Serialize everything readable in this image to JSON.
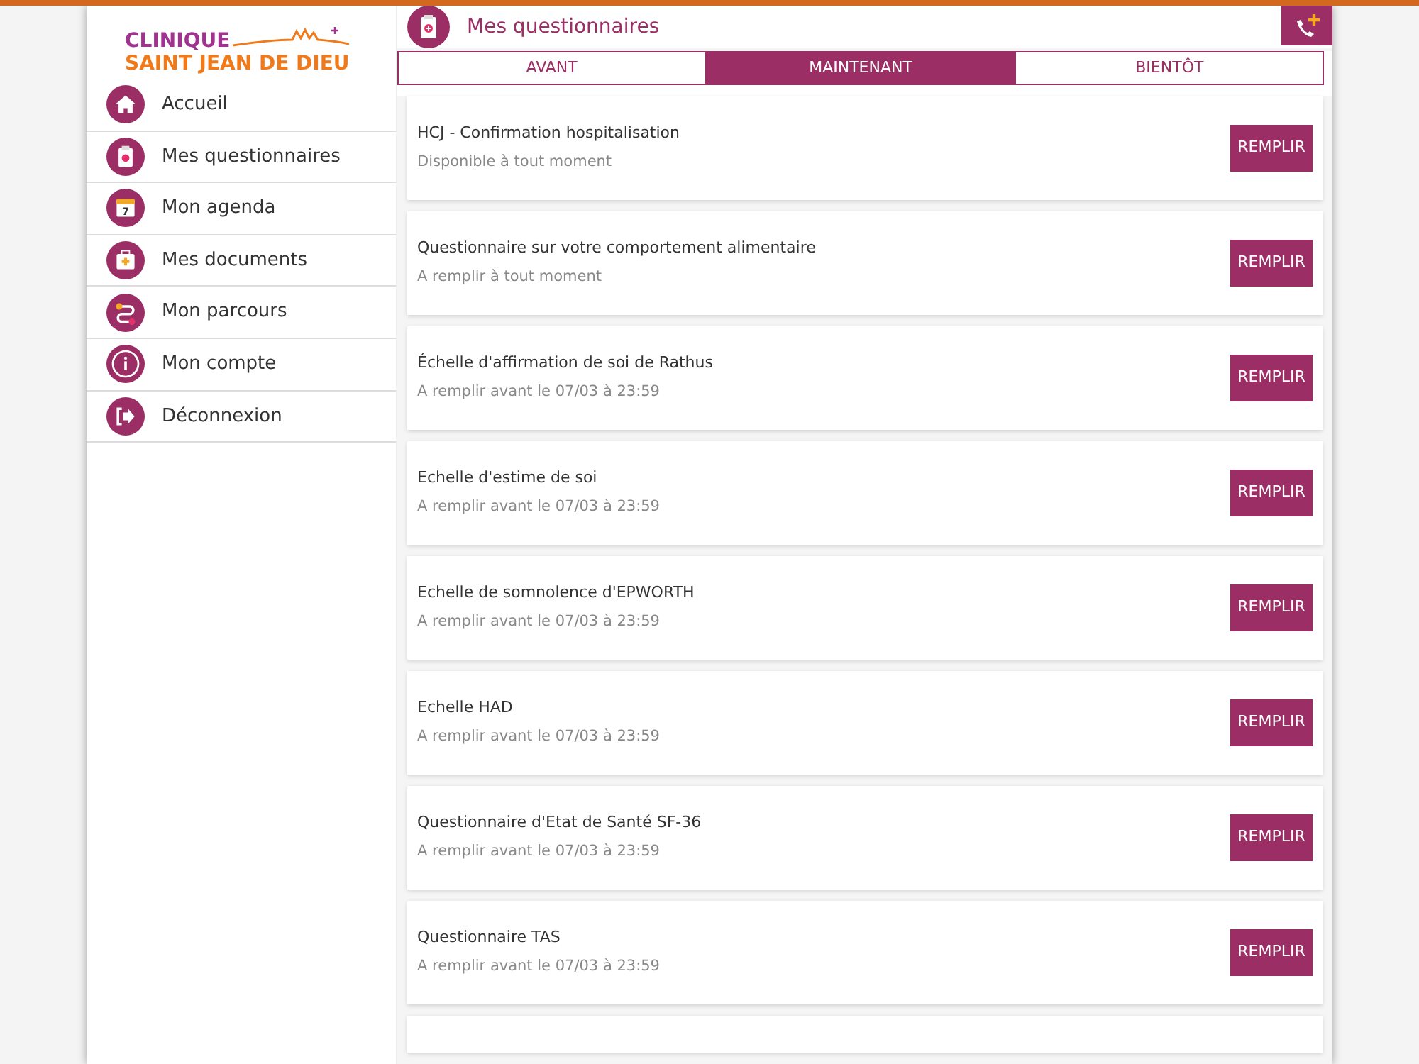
{
  "logo": {
    "line1": "CLINIQUE",
    "line2": "SAINT JEAN DE DIEU"
  },
  "sidebar": {
    "items": [
      {
        "label": "Accueil",
        "selected": false
      },
      {
        "label": "Mes questionnaires",
        "selected": false
      },
      {
        "label": "Mon agenda",
        "icon_text": "7",
        "selected": false
      },
      {
        "label": "Mes documents",
        "selected": false
      },
      {
        "label": "Mon parcours",
        "selected": false
      },
      {
        "label": "Mon compte",
        "selected": false
      },
      {
        "label": "Déconnexion",
        "selected": false
      }
    ]
  },
  "header": {
    "title": "Mes questionnaires"
  },
  "tabs": [
    {
      "label": "AVANT",
      "selected": false
    },
    {
      "label": "MAINTENANT",
      "selected": true
    },
    {
      "label": "BIENTÔT",
      "selected": false
    }
  ],
  "questionnaires": [
    {
      "title": "HCJ - Confirmation hospitalisation",
      "subtitle": "Disponible à tout moment",
      "button": "REMPLIR"
    },
    {
      "title": "Questionnaire sur votre comportement alimentaire",
      "subtitle": "A remplir à tout moment",
      "button": "REMPLIR"
    },
    {
      "title": "Échelle d'affirmation de soi de Rathus",
      "subtitle": "A remplir avant le 07/03 à 23:59",
      "button": "REMPLIR"
    },
    {
      "title": "Echelle d'estime de soi",
      "subtitle": "A remplir avant le 07/03 à 23:59",
      "button": "REMPLIR"
    },
    {
      "title": "Echelle de somnolence d'EPWORTH",
      "subtitle": "A remplir avant le 07/03 à 23:59",
      "button": "REMPLIR"
    },
    {
      "title": "Echelle HAD",
      "subtitle": "A remplir avant le 07/03 à 23:59",
      "button": "REMPLIR"
    },
    {
      "title": "Questionnaire d'Etat de Santé SF-36",
      "subtitle": "A remplir avant le 07/03 à 23:59",
      "button": "REMPLIR"
    },
    {
      "title": "Questionnaire TAS",
      "subtitle": "A remplir avant le 07/03 à 23:59",
      "button": "REMPLIR"
    }
  ]
}
